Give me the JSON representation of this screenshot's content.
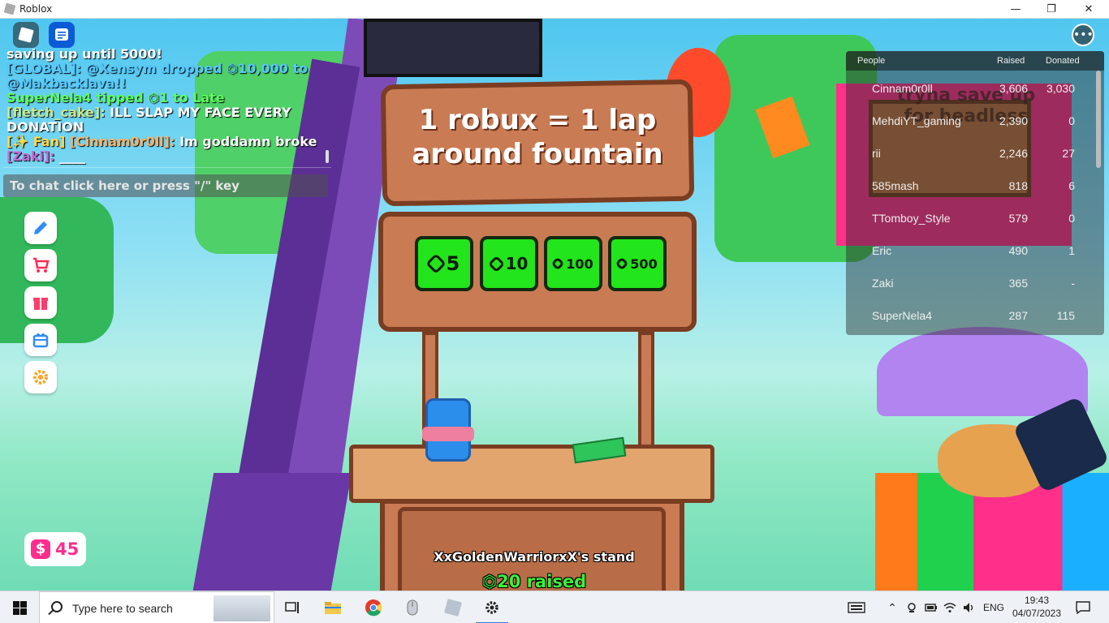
{
  "window": {
    "title": "Roblox",
    "controls": [
      "—",
      "❐",
      "✕"
    ]
  },
  "chat": {
    "lines": [
      {
        "prefix": "",
        "prefix_color": "#ffffff",
        "name": "",
        "name_color": "#ffffff",
        "text": "saving up until 5000!",
        "text_color": "#ffffff"
      },
      {
        "prefix": "",
        "prefix_color": "#ffffff",
        "name": "[GLOBAL]:",
        "name_color": "#55c8ff",
        "text": " @Xensym dropped ⏣10,000 to @Makbacklava!!",
        "text_color": "#55c8ff"
      },
      {
        "prefix": "",
        "prefix_color": "#ffffff",
        "name": "",
        "name_color": "#ffffff",
        "text": "SuperNela4 tipped ⏣1 to Late",
        "text_color": "#5dff5d"
      },
      {
        "prefix": "",
        "prefix_color": "#ffffff",
        "name": "[fletch_cake]:",
        "name_color": "#c9e98b",
        "text": " ILL SLAP MY FACE EVERY DONATION",
        "text_color": "#ffffff"
      },
      {
        "prefix": "[✨ Fan]",
        "prefix_color": "#ffd84a",
        "name": " [Cinnam0r0ll]:",
        "name_color": "#f3b36b",
        "text": " Im goddamn broke",
        "text_color": "#ffffff"
      },
      {
        "prefix": "",
        "prefix_color": "#ffffff",
        "name": "[Zaki]:",
        "name_color": "#c66bd6",
        "text": " ____",
        "text_color": "#ffffff"
      }
    ],
    "input_placeholder": "To chat click here or press \"/\" key"
  },
  "side_buttons": [
    {
      "name": "pencil-icon",
      "color": "#2f8df5"
    },
    {
      "name": "cart-icon",
      "color": "#ff2d55"
    },
    {
      "name": "gift-icon",
      "color": "#ff3b6b"
    },
    {
      "name": "gift-box-icon",
      "color": "#2f8df5"
    },
    {
      "name": "gear-icon",
      "color": "#ffa21f"
    }
  ],
  "currency": {
    "symbol": "$",
    "amount": "45"
  },
  "stand": {
    "title_line1": "1 robux = 1 lap",
    "title_line2": "around fountain",
    "donations": [
      {
        "amount": "5"
      },
      {
        "amount": "10"
      },
      {
        "amount": "100"
      },
      {
        "amount": "500"
      }
    ],
    "owner_label": "XxGoldenWarriorxX's stand",
    "raised_label": "⏣20 raised"
  },
  "leaderboard": {
    "headers": {
      "people": "People",
      "raised": "Raised",
      "donated": "Donated"
    },
    "rows": [
      {
        "name": "Cinnam0r0ll",
        "raised": "3,606",
        "donated": "3,030"
      },
      {
        "name": "MehdiYT_gaming",
        "raised": "2,390",
        "donated": "0"
      },
      {
        "name": "rii",
        "raised": "2,246",
        "donated": "27"
      },
      {
        "name": "585mash",
        "raised": "818",
        "donated": "6"
      },
      {
        "name": "TTomboy_Style",
        "raised": "579",
        "donated": "0"
      },
      {
        "name": "Eric",
        "raised": "490",
        "donated": "1"
      },
      {
        "name": "Zaki",
        "raised": "365",
        "donated": "-"
      },
      {
        "name": "SuperNela4",
        "raised": "287",
        "donated": "115"
      }
    ]
  },
  "background_sign": {
    "line1": "tryna save up",
    "line2": "for headless"
  },
  "taskbar": {
    "search_placeholder": "Type here to search",
    "language": "ENG",
    "time": "19:43",
    "date": "04/07/2023"
  }
}
